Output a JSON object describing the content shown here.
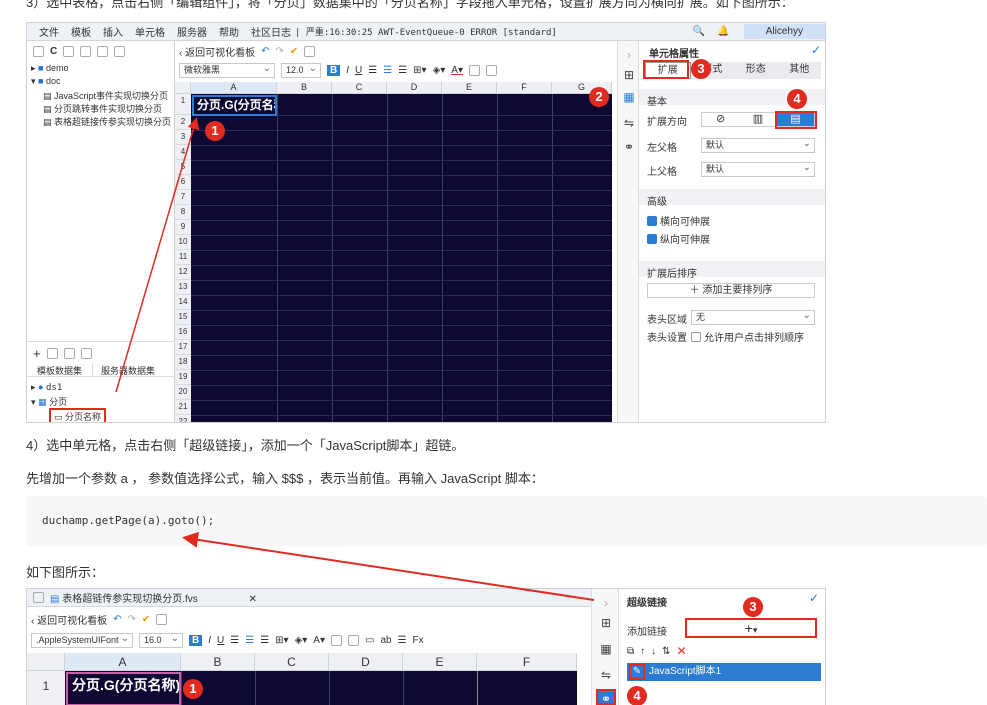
{
  "step3_text": "3）选中表格，点击右侧「编辑组件」，将「分页」数据集中的「分页名称」字段拖入单元格，设置扩展方向为横向扩展。如下图所示：",
  "shot1": {
    "menu": [
      "文件",
      "模板",
      "插入",
      "单元格",
      "服务器",
      "帮助",
      "社区日志"
    ],
    "status": "| 严重:16:30:25 AWT-EventQueue-0 ERROR [standard]",
    "user": "Alicehyy",
    "back_label": "返回可视化看板",
    "font_name": "微软雅黑",
    "font_size": "12.0",
    "tree_items": [
      "demo",
      "doc",
      "JavaScript事件实现切换分页",
      "分页跳转事件实现切换分页",
      "表格超链接传参实现切换分页"
    ],
    "dataset_tabs": [
      "模板数据集",
      "服务器数据集"
    ],
    "datasets": [
      "ds1",
      "分页",
      "分页名称"
    ],
    "columns": [
      "A",
      "B",
      "C",
      "D",
      "E",
      "F",
      "G"
    ],
    "rows": [
      "1",
      "2",
      "3",
      "4",
      "5",
      "6",
      "7",
      "8",
      "9",
      "10",
      "11",
      "12",
      "13",
      "14",
      "15",
      "16",
      "17",
      "18",
      "19",
      "20",
      "21",
      "22"
    ],
    "cell_a1": "分页.G(分页名称)",
    "panel_title": "单元格属性",
    "panel_tabs": [
      "扩展",
      "样式",
      "形态",
      "其他"
    ],
    "basic": "基本",
    "expand_dir": "扩展方向",
    "left_parent": "左父格",
    "top_parent": "上父格",
    "default": "默认",
    "advanced": "高级",
    "horiz": "横向可伸展",
    "vert": "纵向可伸展",
    "sort_after": "扩展后排序",
    "add_sort": "添加主要排列序",
    "header_area": "表头区域",
    "none": "无",
    "header_set": "表头设置",
    "allow_sort": "允许用户点击排列顺序",
    "badges": [
      "1",
      "2",
      "3",
      "4"
    ]
  },
  "step4_text": "4）选中单元格，点击右侧「超级链接」，添加一个「JavaScript脚本」超链。",
  "param_text": "先增加一个参数 a ， 参数值选择公式，输入 $$$ ，表示当前值。再输入 JavaScript 脚本：",
  "code": "duchamp.getPage(a).goto();",
  "as_shown": "如下图所示：",
  "shot2": {
    "file_tab": "表格超链传参实现切换分页.fvs",
    "back_label": "返回可视化看板",
    "font_name": ".AppleSystemUIFont",
    "font_size": "16.0",
    "columns": [
      "A",
      "B",
      "C",
      "D",
      "E",
      "F"
    ],
    "row1": "1",
    "cell_a1": "分页.G(分页名称)",
    "panel_title": "超级链接",
    "add_link": "添加链接",
    "link_item": "JavaScript脚本1",
    "badges": [
      "1",
      "3",
      "4"
    ]
  },
  "colors": {
    "navy": "#0d0933",
    "accent": "#2b7cd3",
    "badge": "#e02b20"
  }
}
